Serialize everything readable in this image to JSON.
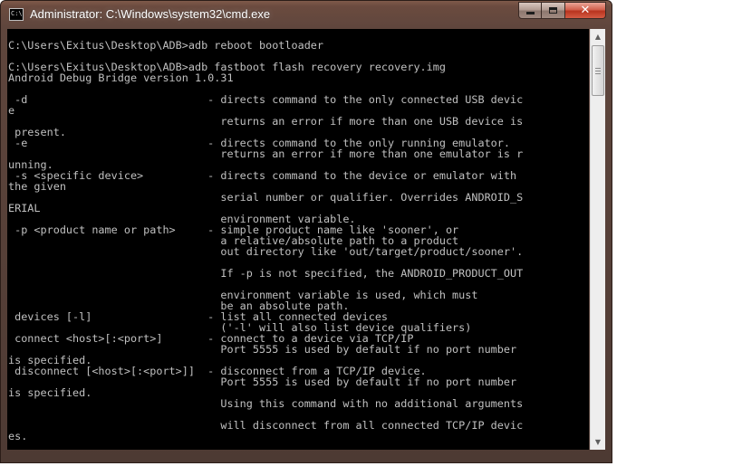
{
  "window": {
    "title": "Administrator: C:\\Windows\\system32\\cmd.exe",
    "icon_label": "C:\\",
    "buttons": {
      "minimize": "minimize-icon",
      "maximize": "maximize-icon",
      "close": "✕"
    }
  },
  "scrollbar": {
    "up_arrow": "▲",
    "down_arrow": "▼"
  },
  "console": {
    "lines": [
      "",
      "C:\\Users\\Exitus\\Desktop\\ADB>adb reboot bootloader",
      "",
      "C:\\Users\\Exitus\\Desktop\\ADB>adb fastboot flash recovery recovery.img",
      "Android Debug Bridge version 1.0.31",
      "",
      " -d                            - directs command to the only connected USB devic",
      "e",
      "                                 returns an error if more than one USB device is",
      " present.",
      " -e                            - directs command to the only running emulator.",
      "                                 returns an error if more than one emulator is r",
      "unning.",
      " -s <specific device>          - directs command to the device or emulator with",
      "the given",
      "                                 serial number or qualifier. Overrides ANDROID_S",
      "ERIAL",
      "                                 environment variable.",
      " -p <product name or path>     - simple product name like 'sooner', or",
      "                                 a relative/absolute path to a product",
      "                                 out directory like 'out/target/product/sooner'.",
      "",
      "                                 If -p is not specified, the ANDROID_PRODUCT_OUT",
      "",
      "                                 environment variable is used, which must",
      "                                 be an absolute path.",
      " devices [-l]                  - list all connected devices",
      "                                 ('-l' will also list device qualifiers)",
      " connect <host>[:<port>]       - connect to a device via TCP/IP",
      "                                 Port 5555 is used by default if no port number",
      "is specified.",
      " disconnect [<host>[:<port>]]  - disconnect from a TCP/IP device.",
      "                                 Port 5555 is used by default if no port number",
      "is specified.",
      "                                 Using this command with no additional arguments",
      "",
      "                                 will disconnect from all connected TCP/IP devic",
      "es."
    ]
  }
}
